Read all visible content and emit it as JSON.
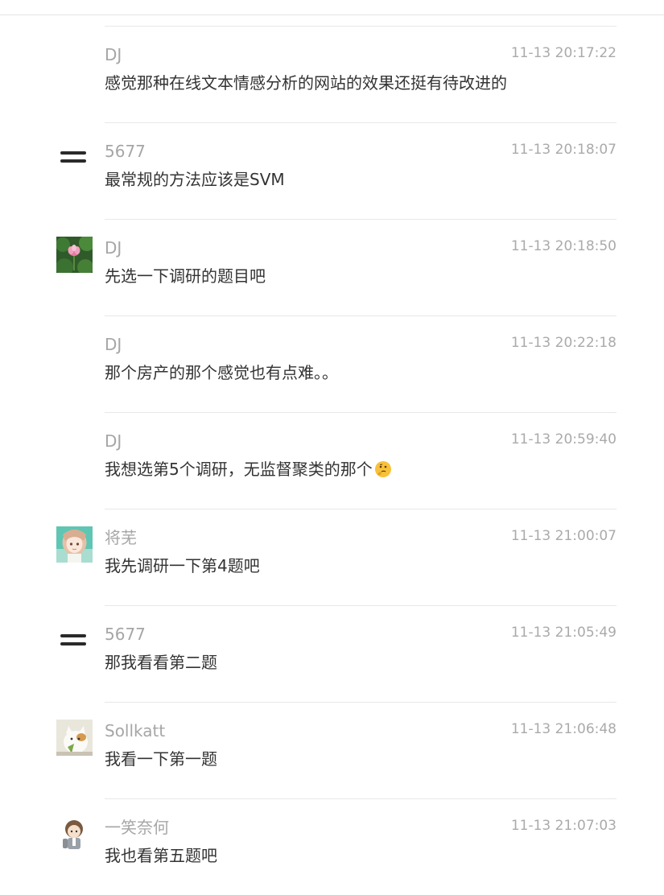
{
  "messages": [
    {
      "name": "DJ",
      "time": "11-13 20:17:22",
      "text": "感觉那种在线文本情感分析的网站的效果还挺有待改进的",
      "avatar": "none"
    },
    {
      "name": "5677",
      "time": "11-13 20:18:07",
      "text": "最常规的方法应该是SVM",
      "avatar": "double-line-icon"
    },
    {
      "name": "DJ",
      "time": "11-13 20:18:50",
      "text": "先选一下调研的题目吧",
      "avatar": "lotus-photo"
    },
    {
      "name": "DJ",
      "time": "11-13 20:22:18",
      "text": "那个房产的那个感觉也有点难。。",
      "avatar": "none"
    },
    {
      "name": "DJ",
      "time": "11-13 20:59:40",
      "text": "我想选第5个调研，无监督聚类的那个",
      "avatar": "none",
      "emoji": "thinking-face-icon"
    },
    {
      "name": "将芜",
      "time": "11-13 21:00:07",
      "text": "我先调研一下第4题吧",
      "avatar": "anime-girl-avatar"
    },
    {
      "name": "5677",
      "time": "11-13 21:05:49",
      "text": "那我看看第二题",
      "avatar": "double-line-icon"
    },
    {
      "name": "Sollkatt",
      "time": "11-13 21:06:48",
      "text": "我看一下第一题",
      "avatar": "cat-avatar"
    },
    {
      "name": "一笑奈何",
      "time": "11-13 21:07:03",
      "text": "我也看第五题吧",
      "avatar": "cartoon-boy-avatar"
    }
  ]
}
